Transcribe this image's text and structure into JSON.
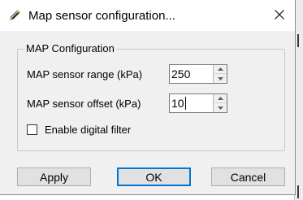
{
  "window": {
    "title": "Map sensor configuration...",
    "icon": "pencil-icon",
    "close": "close-icon"
  },
  "group": {
    "legend": "MAP Configuration"
  },
  "fields": {
    "range": {
      "label": "MAP sensor range (kPa)",
      "value": "250"
    },
    "offset": {
      "label": "MAP sensor offset  (kPa)",
      "value": "10"
    }
  },
  "filter": {
    "label": "Enable digital filter",
    "checked": false
  },
  "buttons": {
    "apply": "Apply",
    "ok": "OK",
    "cancel": "Cancel"
  },
  "colors": {
    "dialog_bg": "#f0f0f0",
    "focus_border": "#0078d7"
  }
}
